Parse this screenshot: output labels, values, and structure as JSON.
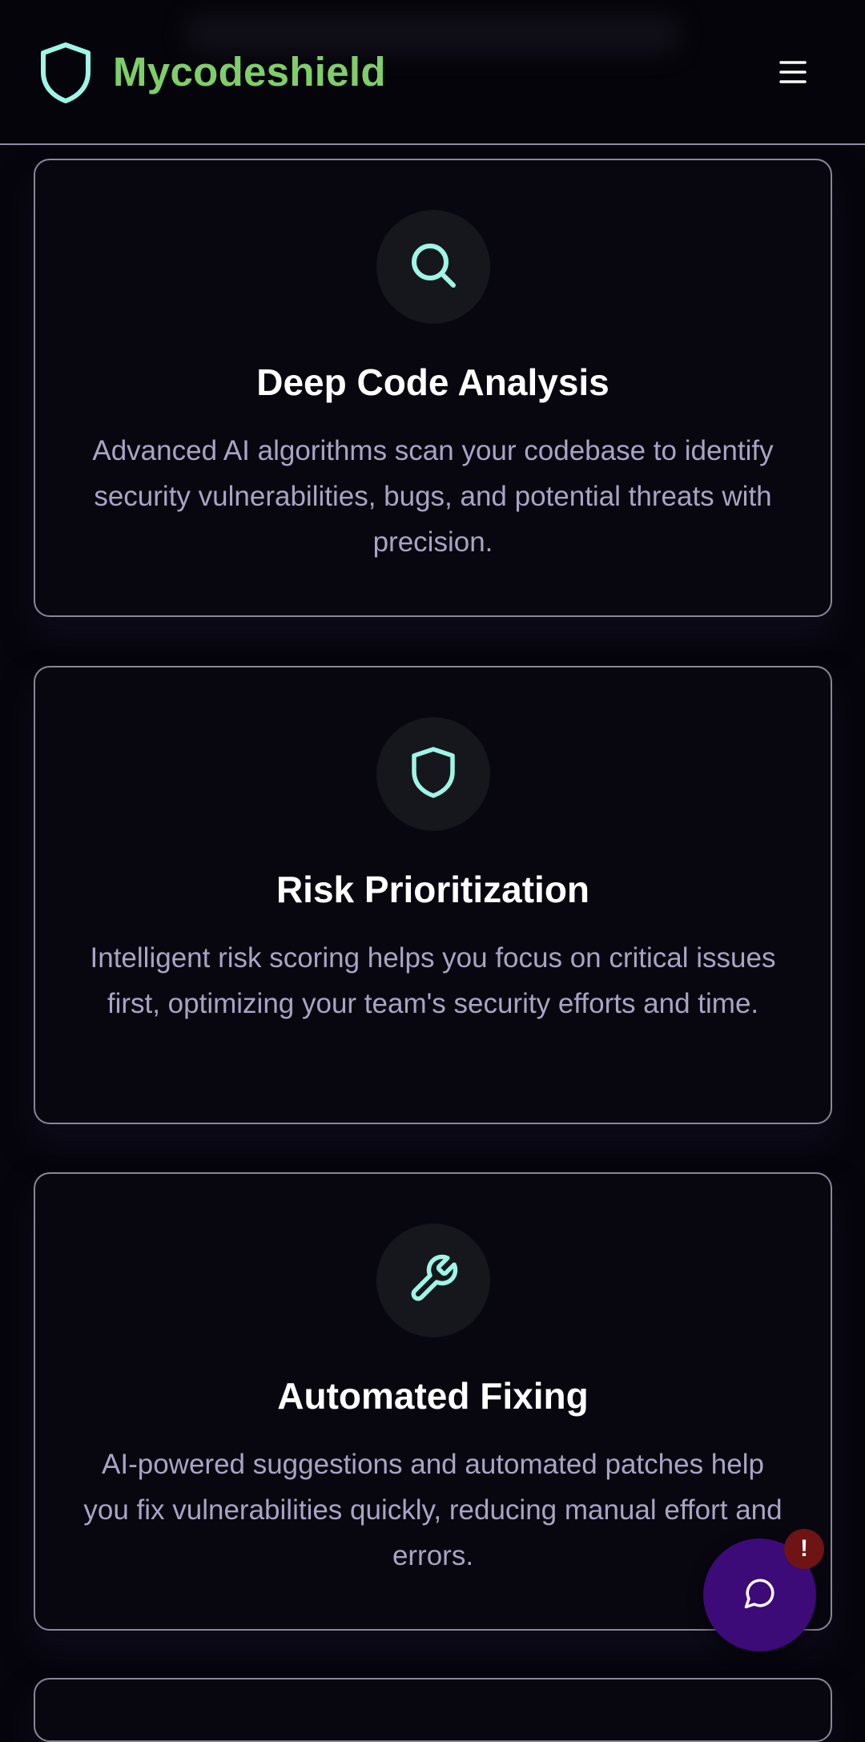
{
  "header": {
    "brand": "Mycodeshield",
    "logo_icon": "shield-icon",
    "menu_icon": "hamburger-menu-icon"
  },
  "features": [
    {
      "icon": "search-icon",
      "title": "Deep Code Analysis",
      "description": "Advanced AI algorithms scan your codebase to identify security vulnerabilities, bugs, and potential threats with precision."
    },
    {
      "icon": "shield-icon",
      "title": "Risk Prioritization",
      "description": "Intelligent risk scoring helps you focus on critical issues first, optimizing your team's security efforts and time."
    },
    {
      "icon": "wrench-icon",
      "title": "Automated Fixing",
      "description": "AI-powered suggestions and automated patches help you fix vulnerabilities quickly, reducing manual effort and errors."
    }
  ],
  "chat": {
    "icon": "chat-bubble-icon",
    "badge": "!"
  },
  "colors": {
    "brand_green": "#7fce6a",
    "icon_accent": "#9ff5e6",
    "background": "#06050d",
    "chat_purple": "#3c0b78",
    "badge_red": "#6e1414"
  }
}
